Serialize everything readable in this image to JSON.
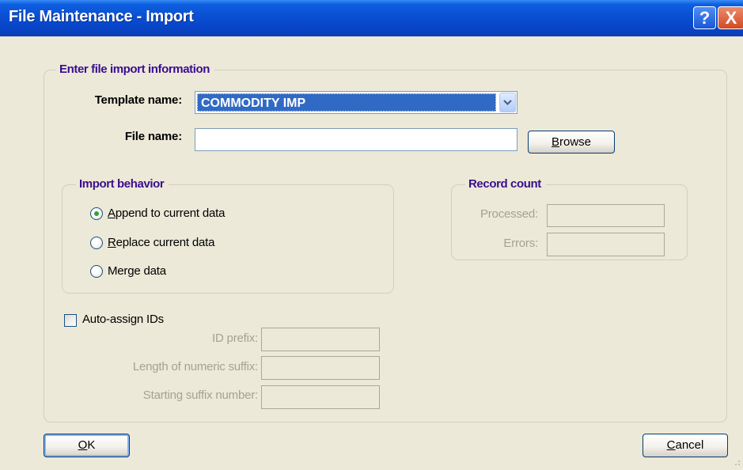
{
  "window": {
    "title": "File Maintenance - Import",
    "help_glyph": "?",
    "close_glyph": "X"
  },
  "import_info": {
    "legend": "Enter file import information",
    "template_label": "Template name:",
    "template_value": "COMMODITY IMP",
    "file_label": "File name:",
    "file_value": "",
    "browse_accel": "B",
    "browse_rest": "rowse"
  },
  "import_behavior": {
    "legend": "Import behavior",
    "selected": "append",
    "options": [
      {
        "key": "append",
        "accel": "A",
        "rest": "ppend to current data"
      },
      {
        "key": "replace",
        "accel": "R",
        "rest": "eplace current data"
      },
      {
        "key": "merge",
        "accel": "",
        "rest": "Merge data"
      }
    ]
  },
  "record_count": {
    "legend": "Record count",
    "processed_label": "Processed:",
    "errors_label": "Errors:"
  },
  "auto_assign": {
    "label": "Auto-assign IDs",
    "checked": false,
    "id_prefix_label": "ID prefix:",
    "suffix_length_label": "Length of numeric suffix:",
    "start_number_label": "Starting suffix number:"
  },
  "buttons": {
    "ok_accel": "O",
    "ok_rest": "K",
    "cancel_accel": "C",
    "cancel_rest": "ancel"
  }
}
